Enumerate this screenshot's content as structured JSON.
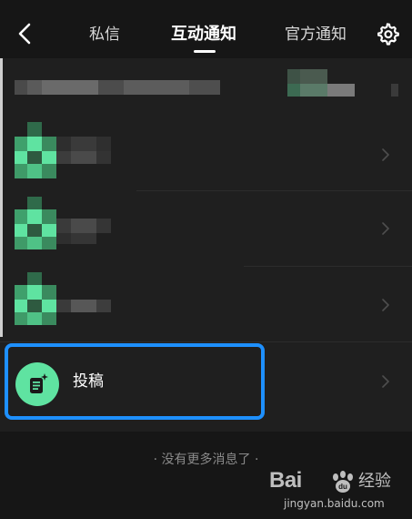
{
  "header": {
    "tabs": [
      {
        "label": "私信",
        "active": false
      },
      {
        "label": "互动通知",
        "active": true
      },
      {
        "label": "官方通知",
        "active": false
      }
    ]
  },
  "list": {
    "tougao": {
      "label": "投稿"
    }
  },
  "footer": {
    "text": "· 没有更多消息了 ·"
  },
  "watermark": {
    "brand": "Bai",
    "suffix": "经验",
    "url": "jingyan.baidu.com"
  },
  "colors": {
    "background": "#161616",
    "list_background": "#1f1f1f",
    "accent_green": "#5fe3a1",
    "highlight_blue": "#1e90ff"
  }
}
